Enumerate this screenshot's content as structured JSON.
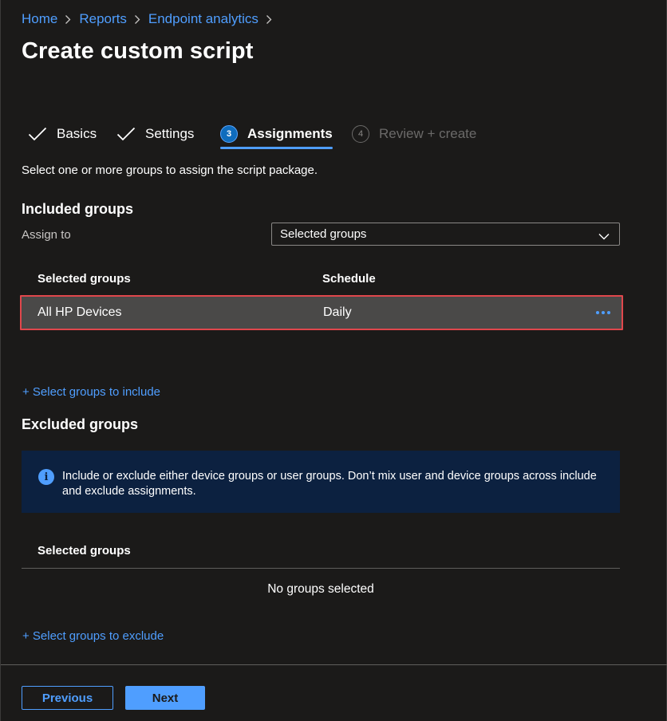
{
  "breadcrumb": {
    "items": [
      {
        "label": "Home"
      },
      {
        "label": "Reports"
      },
      {
        "label": "Endpoint analytics"
      }
    ]
  },
  "page": {
    "title": "Create custom script"
  },
  "tabs": [
    {
      "label": "Basics",
      "state": "completed",
      "icon": "check-icon"
    },
    {
      "label": "Settings",
      "state": "completed",
      "icon": "check-icon"
    },
    {
      "label": "Assignments",
      "state": "active",
      "step": "3"
    },
    {
      "label": "Review + create",
      "state": "disabled",
      "step": "4"
    }
  ],
  "instruction": "Select one or more groups to assign the script package.",
  "included": {
    "heading": "Included groups",
    "assign_label": "Assign to",
    "assign_value": "Selected groups",
    "columns": [
      "Selected groups",
      "Schedule"
    ],
    "rows": [
      {
        "group": "All HP Devices",
        "schedule": "Daily"
      }
    ],
    "add_link": "+ Select groups to include"
  },
  "excluded": {
    "heading": "Excluded groups",
    "info": "Include or exclude either device groups or user groups. Don’t mix user and device groups across include and exclude assignments.",
    "column": "Selected groups",
    "empty": "No groups selected",
    "add_link": "+ Select groups to exclude"
  },
  "footer": {
    "previous": "Previous",
    "next": "Next"
  },
  "colors": {
    "background": "#1b1a19",
    "accent": "#4f9eff",
    "selected_row": "#4a4948",
    "highlight_border": "#e0474c",
    "info_bar": "#0c2140"
  }
}
